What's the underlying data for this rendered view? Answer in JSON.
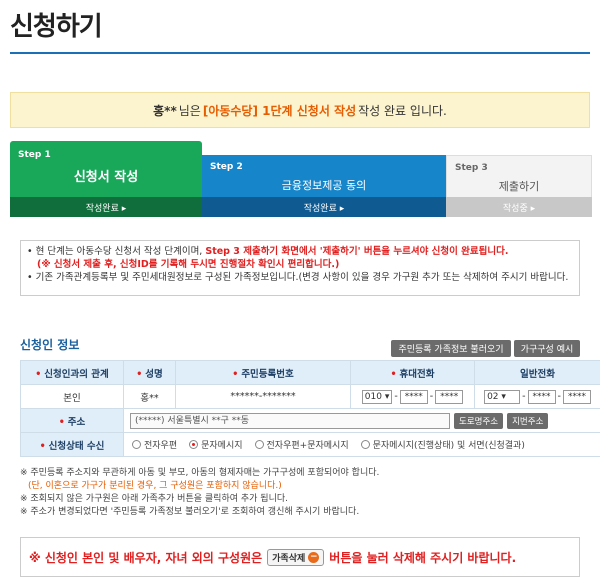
{
  "page_title": "신청하기",
  "notice": {
    "name": "홍**",
    "text_pre": "님은",
    "highlight": "[아동수당] 1단계 신청서 작성",
    "text_post": "작성 완료 입니다."
  },
  "steps": [
    {
      "num": "Step 1",
      "label": "신청서 작성",
      "status": "작성완료 ▸"
    },
    {
      "num": "Step 2",
      "label": "금융정보제공 동의",
      "status": "작성완료 ▸"
    },
    {
      "num": "Step 3",
      "label": "제출하기",
      "status": "작성중 ▸"
    }
  ],
  "info": {
    "line1_pre": "• 현 단계는 아동수당 신청서 작성 단계이며,",
    "line1_red": "Step 3 제출하기 화면에서 '제출하기' 버튼을 누르셔야 신청이 완료됩니다.",
    "line2_red": "(※ 신청서 제출 후, 신청ID를 기록해 두시면 진행절차 확인시 편리합니다.)",
    "line3": "• 기존 가족관계등록부 및 주민세대원정보로 구성된 가족정보입니다.(변경 사항이 있을 경우 가구원 추가 또는 삭제하여 주시기 바랍니다."
  },
  "section_title": "신청인 정보",
  "buttons": {
    "load_family": "주민등록 가족정보 불러오기",
    "household_example": "가구구성 예시",
    "road_address": "도로명주소",
    "lot_address": "지번주소"
  },
  "table": {
    "headers": [
      "신청인과의 관계",
      "성명",
      "주민등록번호",
      "휴대전화",
      "일반전화"
    ],
    "row": {
      "relation": "본인",
      "name": "홍**",
      "rrn": "******-*******",
      "mobile_prefix": "010",
      "mobile_mid": "****",
      "mobile_last": "****",
      "phone_prefix": "02",
      "phone_mid": "****",
      "phone_last": "****"
    },
    "address_label": "주소",
    "address_value": "(*****) 서울특별시 **구 **동",
    "receive_label": "신청상태 수신",
    "receive_options": [
      "전자우편",
      "문자메시지",
      "전자우편+문자메시지",
      "문자메시지(진행상태) 및 서면(신청결과)"
    ],
    "receive_selected": 1
  },
  "notes": [
    "※ 주민등록 주소지와 무관하게 아동 및 부모, 아동의 형제자매는 가구구성에 포함되어야 합니다.",
    "(단, 이혼으로 가구가 분리된 경우, 그 구성원은 포함하지 않습니다.)",
    "※ 조회되지 않은 가구원은 아래 가족추가 버튼을 클릭하여 추가 됩니다.",
    "※ 주소가 변경되었다면 '주민등록 가족정보 불러오기'로 조회하여 갱신해 주시기 바랍니다."
  ],
  "warning": {
    "pre": "※ 신청인 본인 및 배우자, 자녀 외의 구성원은",
    "pill": "가족삭제",
    "post": "버튼을 눌러 삭제해 주시기 바랍니다."
  },
  "colors": {
    "step1": "#19a75a",
    "step2": "#1785c9",
    "accent_red": "#e02020",
    "notice_bg": "#fcf3cf"
  }
}
